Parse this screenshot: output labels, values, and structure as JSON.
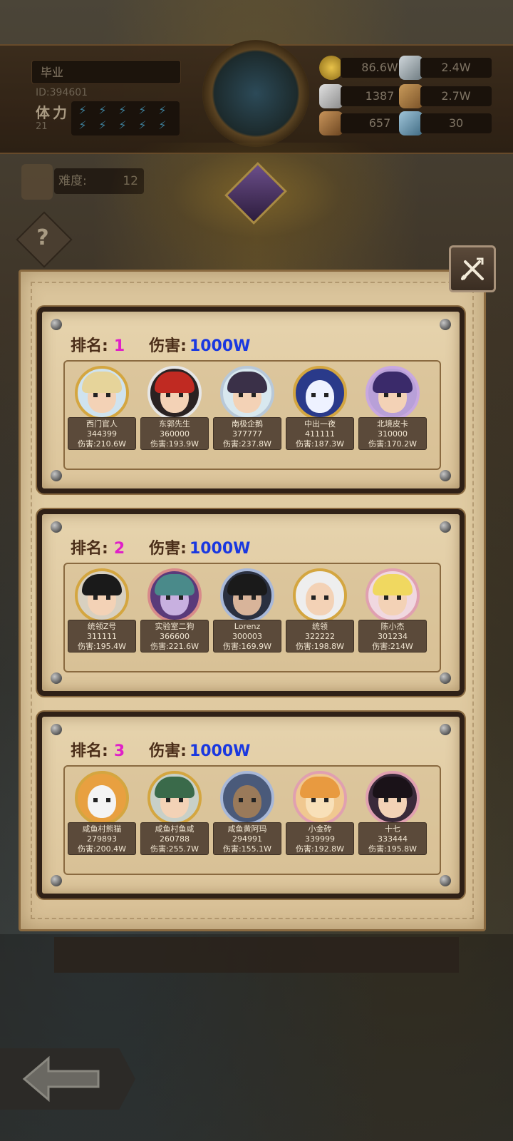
{
  "player": {
    "name": "毕业",
    "id_text": "ID:394601",
    "stamina_label": "体力",
    "stamina_value": "21"
  },
  "resources": {
    "gold": "86.6W",
    "crystal": "2.4W",
    "ore": "1387",
    "leather": "2.7W",
    "wood": "657",
    "ice": "30"
  },
  "difficulty": {
    "label": "难度:",
    "value": "12"
  },
  "ranks": [
    {
      "rank_label": "排名:",
      "rank": "1",
      "damage_label": "伤害:",
      "damage": "1000W",
      "heroes": [
        {
          "name": "西门官人",
          "id": "344399",
          "damage": "伤害:210.6W"
        },
        {
          "name": "东郭先生",
          "id": "360000",
          "damage": "伤害:193.9W"
        },
        {
          "name": "南极企鹅",
          "id": "377777",
          "damage": "伤害:237.8W"
        },
        {
          "name": "中出一夜",
          "id": "411111",
          "damage": "伤害:187.3W"
        },
        {
          "name": "北境皮卡",
          "id": "310000",
          "damage": "伤害:170.2W"
        }
      ]
    },
    {
      "rank_label": "排名:",
      "rank": "2",
      "damage_label": "伤害:",
      "damage": "1000W",
      "heroes": [
        {
          "name": "统领Z号",
          "id": "311111",
          "damage": "伤害:195.4W"
        },
        {
          "name": "实验室二狗",
          "id": "366600",
          "damage": "伤害:221.6W"
        },
        {
          "name": "Lorenz",
          "id": "300003",
          "damage": "伤害:169.9W"
        },
        {
          "name": "统领",
          "id": "322222",
          "damage": "伤害:198.8W"
        },
        {
          "name": "陈小杰",
          "id": "301234",
          "damage": "伤害:214W"
        }
      ]
    },
    {
      "rank_label": "排名:",
      "rank": "3",
      "damage_label": "伤害:",
      "damage": "1000W",
      "heroes": [
        {
          "name": "咸鱼村熊猫",
          "id": "279893",
          "damage": "伤害:200.4W"
        },
        {
          "name": "咸鱼村鱼咸",
          "id": "260788",
          "damage": "伤害:255.7W"
        },
        {
          "name": "咸鱼黄阿玛",
          "id": "294991",
          "damage": "伤害:155.1W"
        },
        {
          "name": "小金砖",
          "id": "339999",
          "damage": "伤害:192.8W"
        },
        {
          "name": "十七",
          "id": "333444",
          "damage": "伤害:195.8W"
        }
      ]
    }
  ],
  "colors": {
    "rank_number": "#e020c8",
    "damage_value": "#1a38e0",
    "panel": "#e3cfa6",
    "frame": "#2f2016"
  },
  "icons": {
    "close": "crossed-swords-icon",
    "help": "question-mark-icon",
    "back": "back-arrow-icon"
  }
}
